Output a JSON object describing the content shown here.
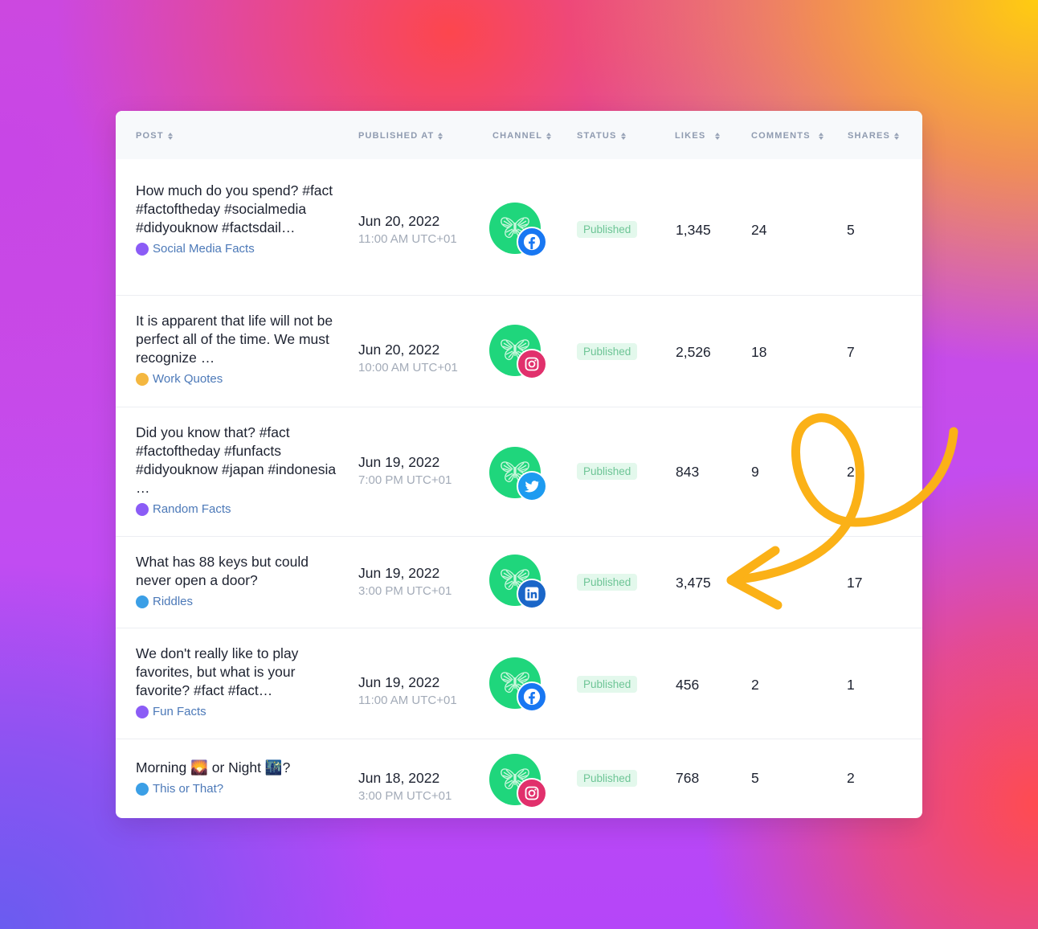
{
  "table": {
    "headers": {
      "post": "POST",
      "published_at": "PUBLISHED AT",
      "channel": "CHANNEL",
      "status": "STATUS",
      "likes": "LIKES",
      "comments": "COMMENTS",
      "shares": "SHARES"
    },
    "rows": [
      {
        "post": "How much do you spend? #fact #factoftheday #socialmedia #didyouknow #factsdail…",
        "category": "Social Media Facts",
        "category_color": "#8b5cf6",
        "date": "Jun 20, 2022",
        "time": "11:00 AM UTC+01",
        "channel": "facebook",
        "status": "Published",
        "likes": "1,345",
        "comments": "24",
        "shares": "5"
      },
      {
        "post": "It is apparent that life will not be perfect all of the time. We must recognize …",
        "category": "Work Quotes",
        "category_color": "#f4b740",
        "date": "Jun 20, 2022",
        "time": "10:00 AM UTC+01",
        "channel": "instagram",
        "status": "Published",
        "likes": "2,526",
        "comments": "18",
        "shares": "7"
      },
      {
        "post": "Did you know that? #fact #factoftheday #funfacts #didyouknow #japan #indonesia …",
        "category": "Random Facts",
        "category_color": "#8b5cf6",
        "date": "Jun 19, 2022",
        "time": "7:00 PM UTC+01",
        "channel": "twitter",
        "status": "Published",
        "likes": "843",
        "comments": "9",
        "shares": "2"
      },
      {
        "post": "What has 88 keys but could never open a door?",
        "category": "Riddles",
        "category_color": "#3b9fe6",
        "date": "Jun 19, 2022",
        "time": "3:00 PM UTC+01",
        "channel": "linkedin",
        "status": "Published",
        "likes": "3,475",
        "comments": "",
        "shares": "17"
      },
      {
        "post": "We don't really like to play favorites, but what is your favorite? #fact #fact…",
        "category": "Fun Facts",
        "category_color": "#8b5cf6",
        "date": "Jun 19, 2022",
        "time": "11:00 AM UTC+01",
        "channel": "facebook",
        "status": "Published",
        "likes": "456",
        "comments": "2",
        "shares": "1"
      },
      {
        "post": "Morning 🌄 or Night 🌃?",
        "category": "This or That?",
        "category_color": "#3b9fe6",
        "date": "Jun 18, 2022",
        "time": "3:00 PM UTC+01",
        "channel": "instagram",
        "status": "Published",
        "likes": "768",
        "comments": "5",
        "shares": "2"
      }
    ]
  },
  "icons": {
    "avatar": "butterfly-icon",
    "facebook": "facebook-icon",
    "instagram": "instagram-icon",
    "twitter": "twitter-icon",
    "linkedin": "linkedin-icon",
    "sort": "sort-icon"
  },
  "colors": {
    "avatar_bg": "#1fd67c",
    "facebook": "#1877f2",
    "instagram": "#e1306c",
    "twitter": "#1d9bf0",
    "linkedin": "#1a66c8",
    "status_bg": "#e3f8ec",
    "status_text": "#6ec596",
    "annotation_arrow": "#fbb117"
  }
}
